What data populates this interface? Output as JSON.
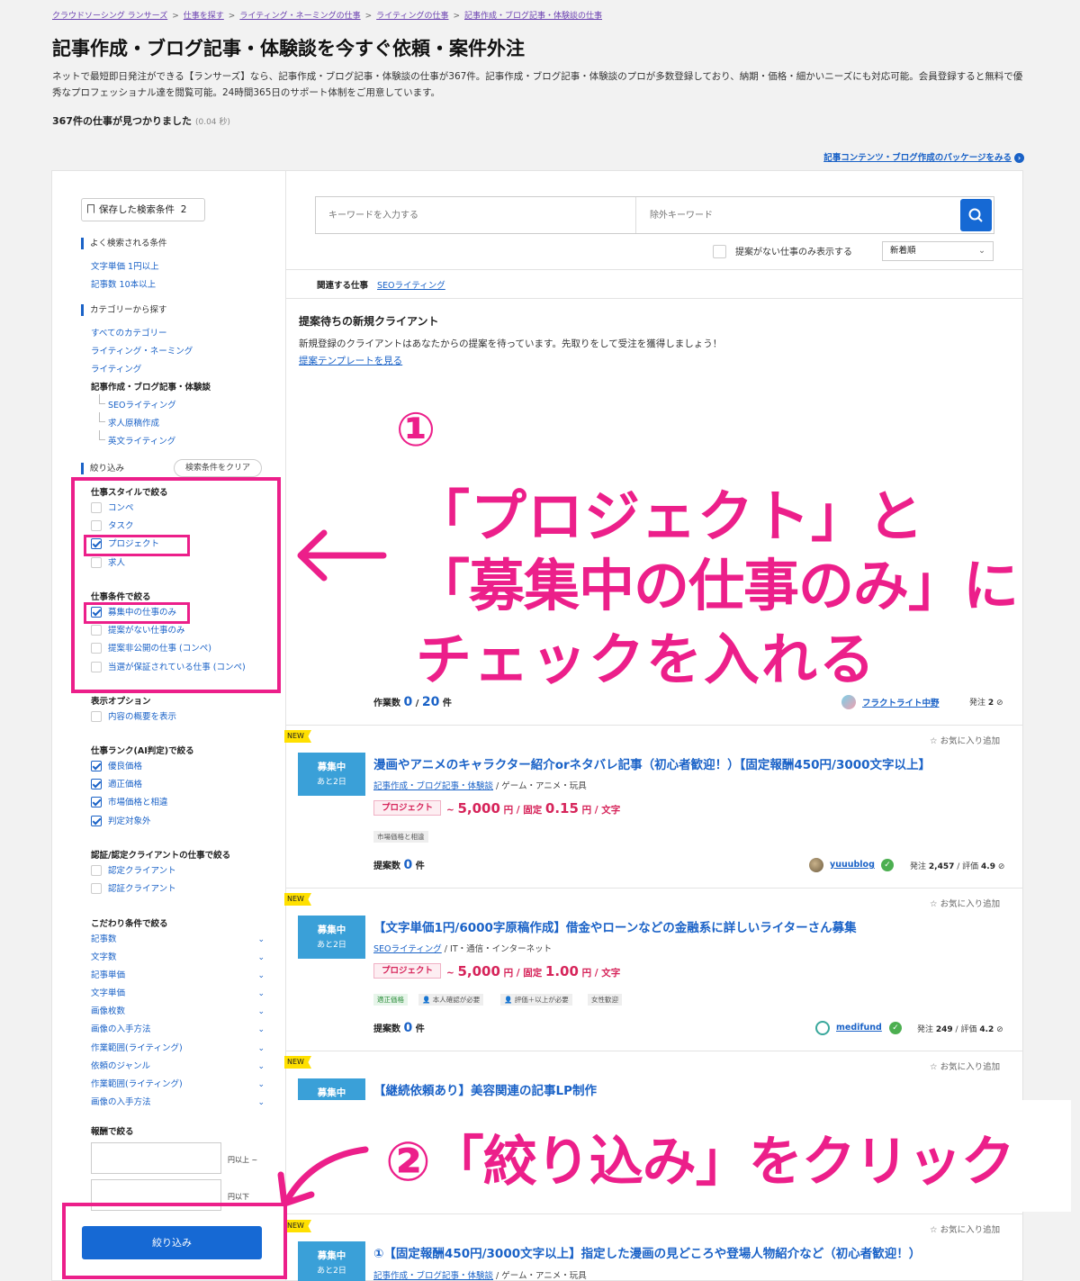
{
  "breadcrumb": [
    "クラウドソーシング ランサーズ",
    "仕事を探す",
    "ライティング・ネーミングの仕事",
    "ライティングの仕事",
    "記事作成・ブログ記事・体験談の仕事"
  ],
  "breadcrumb_sep": ">",
  "page_title": "記事作成・ブログ記事・体験談を今すぐ依頼・案件外注",
  "intro": "ネットで最短即日発注ができる【ランサーズ】なら、記事作成・ブログ記事・体験談の仕事が367件。記事作成・ブログ記事・体験談のプロが多数登録しており、納期・価格・細かいニーズにも対応可能。会員登録すると無料で優秀なプロフェッショナル達を閲覧可能。24時間365日のサポート体制をご用意しています。",
  "result_count": "367件の仕事が見つかりました",
  "result_time": "(0.04 秒)",
  "package_link": "記事コンテンツ・ブログ作成のパッケージをみる",
  "sidebar": {
    "saved_search": "保存した検索条件",
    "saved_count": "2",
    "popular_head": "よく検索される条件",
    "popular": [
      "文字単価 1円以上",
      "記事数 10本以上"
    ],
    "category_head": "カテゴリーから探す",
    "categories": [
      "すべてのカテゴリー",
      "ライティング・ネーミング",
      "ライティング"
    ],
    "current_category": "記事作成・ブログ記事・体験談",
    "sub_categories": [
      "SEOライティング",
      "求人原稿作成",
      "英文ライティング"
    ],
    "filter_label": "絞り込み",
    "clear_button": "検索条件をクリア",
    "style_head": "仕事スタイルで絞る",
    "style_options": [
      "コンペ",
      "タスク",
      "プロジェクト",
      "求人"
    ],
    "condition_head": "仕事条件で絞る",
    "condition_options": [
      "募集中の仕事のみ",
      "提案がない仕事のみ",
      "提案非公開の仕事 (コンペ)",
      "当選が保証されている仕事 (コンペ)"
    ],
    "display_head": "表示オプション",
    "display_options": [
      "内容の概要を表示"
    ],
    "rank_head": "仕事ランク(AI判定)で絞る",
    "rank_options": [
      "優良価格",
      "適正価格",
      "市場価格と相違",
      "判定対象外"
    ],
    "cert_head": "認証/認定クライアントの仕事で絞る",
    "cert_options": [
      "認定クライアント",
      "認証クライアント"
    ],
    "detail_head": "こだわり条件で絞る",
    "detail_options": [
      "記事数",
      "文字数",
      "記事単価",
      "文字単価",
      "画像枚数",
      "画像の入手方法",
      "作業範囲(ライティング)",
      "依頼のジャンル",
      "作業範囲(ライティング)",
      "画像の入手方法"
    ],
    "reward_head": "報酬で絞る",
    "reward_min_unit": "円以上 ~",
    "reward_max_unit": "円以下",
    "submit_button": "絞り込み"
  },
  "search": {
    "keyword_placeholder": "キーワードを入力する",
    "exclude_placeholder": "除外キーワード",
    "no_proposal_label": "提案がない仕事のみ表示する",
    "sort_value": "新着順"
  },
  "related": {
    "label": "関連する仕事",
    "link": "SEOライティング"
  },
  "new_client": {
    "title": "提案待ちの新規クライアント",
    "desc": "新規登録のクライアントはあなたからの提案を待っています。先取りをして受注を獲得しましょう！",
    "template_link": "提案テンプレートを見る"
  },
  "first_card_footer": {
    "label": "作業数",
    "done": "0",
    "slash": "/",
    "total": "20",
    "unit": "件",
    "client": "フラクトライト中野",
    "orders_label": "発注",
    "orders": "2"
  },
  "jobs": [
    {
      "new": "NEW",
      "fav": "お気に入り追加",
      "status": "募集中",
      "remaining": "あと2日",
      "title": "漫画やアニメのキャラクター紹介orネタバレ記事（初心者歓迎！）【固定報酬450円/3000文字以上】",
      "category": "記事作成・ブログ記事・体験談",
      "genre": "ゲーム・アニメ・玩具",
      "type": "プロジェクト",
      "price_prefix": "~",
      "price_amount": "5,000",
      "price_unit": "円 / 固定",
      "unit_price": "0.15",
      "unit_suffix": "円 / 文字",
      "tags": [
        "市場価格と相違"
      ],
      "proposal_label": "提案数",
      "proposals": "0",
      "proposal_unit": "件",
      "client": "yuuublog",
      "orders_label": "発注",
      "orders": "2,457",
      "rating_label": "評価",
      "rating": "4.9"
    },
    {
      "new": "NEW",
      "fav": "お気に入り追加",
      "status": "募集中",
      "remaining": "あと2日",
      "title": "【文字単価1円/6000字原稿作成】借金やローンなどの金融系に詳しいライターさん募集",
      "category": "SEOライティング",
      "genre": "IT・通信・インターネット",
      "type": "プロジェクト",
      "price_prefix": "~",
      "price_amount": "5,000",
      "price_unit": "円 / 固定",
      "unit_price": "1.00",
      "unit_suffix": "円 / 文字",
      "tags": [
        "適正価格",
        "本人確認が必要",
        "評価＋以上が必要",
        "女性歓迎"
      ],
      "proposal_label": "提案数",
      "proposals": "0",
      "proposal_unit": "件",
      "client": "medifund",
      "orders_label": "発注",
      "orders": "249",
      "rating_label": "評価",
      "rating": "4.2"
    },
    {
      "new": "NEW",
      "fav": "お気に入り追加",
      "status": "募集中",
      "title": "【継続依頼あり】美容関連の記事LP制作"
    },
    {
      "new": "NEW",
      "fav": "お気に入り追加",
      "status": "募集中",
      "remaining": "あと2日",
      "title": "①【固定報酬450円/3000文字以上】指定した漫画の見どころや登場人物紹介など（初心者歓迎！）",
      "category": "記事作成・ブログ記事・体験談",
      "genre": "ゲーム・アニメ・玩具"
    }
  ],
  "annotations": {
    "step1_num": "①",
    "step1_line1": "「プロジェクト」と",
    "step1_line2": "「募集中の仕事のみ」に",
    "step1_line3": "チェックを入れる",
    "step2": "②「絞り込み」をクリック",
    "arrow1": "←",
    "color": "#ec1f8a"
  },
  "colors": {
    "accent": "#1669d4",
    "link": "#1a62c7",
    "status": "#3aa0d8",
    "project": "#d6245a",
    "annotation": "#ec1f8a",
    "new_badge": "#ffe000"
  }
}
